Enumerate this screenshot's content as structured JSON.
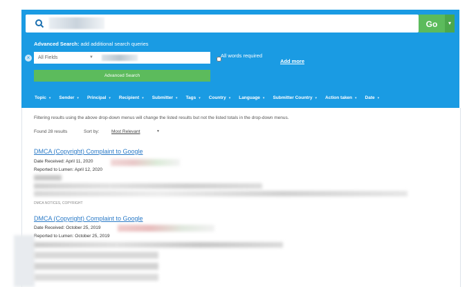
{
  "search": {
    "go_label": "Go",
    "caret": "▾"
  },
  "advanced": {
    "title_bold": "Advanced Search:",
    "title_rest": " add additional search queries",
    "field_select": "All Fields",
    "all_words_label": "All words required",
    "add_more_label": "Add more",
    "button_label": "Advanced Search"
  },
  "filters": [
    "Topic",
    "Sender",
    "Principal",
    "Recipient",
    "Submitter",
    "Tags",
    "Country",
    "Language",
    "Submitter Country",
    "Action taken",
    "Date"
  ],
  "results_meta": {
    "note": "Filtering results using the above drop-down menus will change the listed results but not the listed totals in the drop-down menus.",
    "count": "Found 28 results",
    "sort_label": "Sort by:",
    "sort_value": "Most Relevant"
  },
  "results": [
    {
      "title": "DMCA (Copyright) Complaint to Google",
      "date_received": "Date Received: April 11, 2020",
      "reported": "Reported to Lumen: April 12, 2020",
      "tags": "DMCA NOTICES, COPYRIGHT"
    },
    {
      "title": "DMCA (Copyright) Complaint to Google",
      "date_received": "Date Received: October 25, 2019",
      "reported": "Reported to Lumen: October 25, 2019"
    }
  ],
  "colors": {
    "panel": "#1a9be3",
    "green": "#5cbb5c",
    "link": "#2a7ac7"
  }
}
